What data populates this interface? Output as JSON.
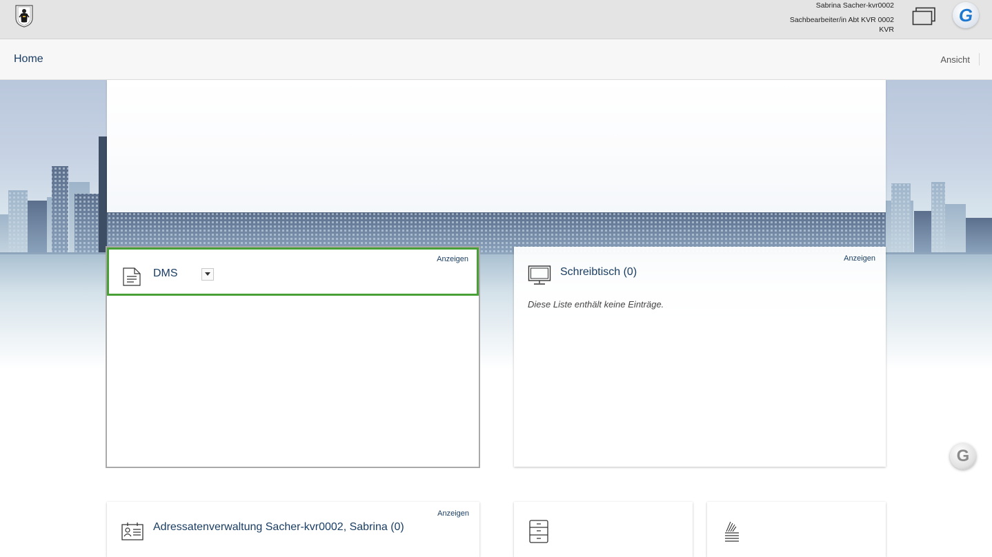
{
  "header": {
    "crest_icon": "munich-crest-icon",
    "user_name": "Sabrina Sacher-kvr0002",
    "user_role": "Sachbearbeiter/in Abt KVR 0002",
    "user_org": "KVR",
    "windows_icon": "windows-icon",
    "logo_letter": "G"
  },
  "nav": {
    "home": "Home",
    "view": "Ansicht"
  },
  "cards": {
    "dms": {
      "title": "DMS",
      "show": "Anzeigen",
      "icon": "document-icon"
    },
    "desk": {
      "title": "Schreibtisch (0)",
      "show": "Anzeigen",
      "empty": "Diese Liste enthält keine Einträge.",
      "icon": "monitor-icon"
    },
    "addresses": {
      "title": "Adressatenverwaltung Sacher-kvr0002, Sabrina (0)",
      "show": "Anzeigen",
      "icon": "address-card-icon"
    },
    "cabinet": {
      "icon": "filing-cabinet-icon"
    },
    "stack": {
      "icon": "document-stack-icon"
    }
  },
  "floating": {
    "letter": "G"
  },
  "colors": {
    "accent": "#1a3d63",
    "highlight": "#48a037"
  }
}
